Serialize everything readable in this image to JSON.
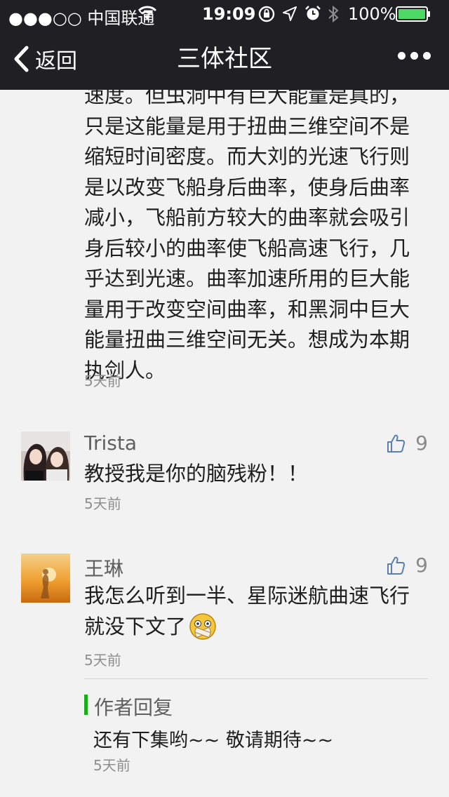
{
  "status": {
    "carrier": "●●●○○ 中国联通",
    "time": "19:09",
    "battery": "100%"
  },
  "nav": {
    "back_label": "返回",
    "title": "三体社区"
  },
  "comments": [
    {
      "text_lines": [
        "速度。但虫洞中有巨大能量是真的，",
        "只是这能量是用于扭曲三维空间不是",
        "缩短时间密度。而大刘的光速飞行则",
        "是以改变飞船身后曲率，使身后曲率",
        "减小，飞船前方较大的曲率就会吸引",
        "身后较小的曲率使飞船高速飞行，几",
        "乎达到光速。曲率加速所用的巨大能",
        "量用于改变空间曲率，和黑洞中巨大",
        "能量扭曲三维空间无关。想成为本期",
        "执剑人。"
      ],
      "time": "5天前"
    },
    {
      "name": "Trista",
      "likes": "9",
      "text": "教授我是你的脑残粉！！",
      "time": "5天前"
    },
    {
      "name": "王琳",
      "likes": "9",
      "text_lines": [
        "我怎么听到一半、星际迷航曲速飞行",
        "就没下文了"
      ],
      "time": "5天前",
      "reply": {
        "label": "作者回复",
        "text": "还有下集哟~~ 敬请期待~~",
        "time": "5天前"
      }
    }
  ],
  "colors": {
    "nav_bg": "#201f24",
    "page_bg": "#f2f2f2",
    "reply_accent": "#1aad19",
    "battery": "#4cd964"
  }
}
